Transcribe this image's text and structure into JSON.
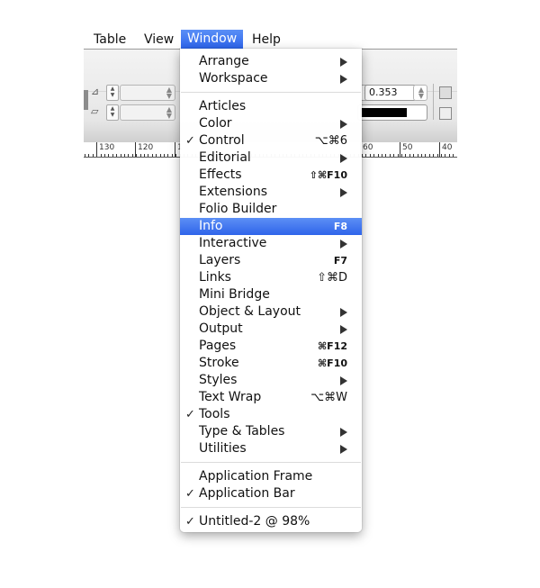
{
  "menubar": {
    "items": [
      {
        "label": "Table"
      },
      {
        "label": "View"
      },
      {
        "label": "Window",
        "active": true
      },
      {
        "label": "Help"
      }
    ]
  },
  "toolbar": {
    "stroke_weight_value": "0.353 mm",
    "ruler_labels": [
      "130",
      "120",
      "1",
      "60",
      "50",
      "40"
    ]
  },
  "window_menu": {
    "groups": [
      [
        {
          "label": "Arrange",
          "submenu": true
        },
        {
          "label": "Workspace",
          "submenu": true
        }
      ],
      [
        {
          "label": "Articles"
        },
        {
          "label": "Color",
          "submenu": true
        },
        {
          "label": "Control",
          "checked": true,
          "shortcut": "⌥⌘6"
        },
        {
          "label": "Editorial",
          "submenu": true
        },
        {
          "label": "Effects",
          "shortcut": "⇧⌘F10"
        },
        {
          "label": "Extensions",
          "submenu": true
        },
        {
          "label": "Folio Builder"
        },
        {
          "label": "Info",
          "shortcut": "F8",
          "highlighted": true
        },
        {
          "label": "Interactive",
          "submenu": true
        },
        {
          "label": "Layers",
          "shortcut": "F7"
        },
        {
          "label": "Links",
          "shortcut": "⇧⌘D"
        },
        {
          "label": "Mini Bridge"
        },
        {
          "label": "Object & Layout",
          "submenu": true
        },
        {
          "label": "Output",
          "submenu": true
        },
        {
          "label": "Pages",
          "shortcut": "⌘F12"
        },
        {
          "label": "Stroke",
          "shortcut": "⌘F10"
        },
        {
          "label": "Styles",
          "submenu": true
        },
        {
          "label": "Text Wrap",
          "shortcut": "⌥⌘W"
        },
        {
          "label": "Tools",
          "checked": true
        },
        {
          "label": "Type & Tables",
          "submenu": true
        },
        {
          "label": "Utilities",
          "submenu": true
        }
      ],
      [
        {
          "label": "Application Frame"
        },
        {
          "label": "Application Bar",
          "checked": true
        }
      ],
      [
        {
          "label": "Untitled-2 @ 98%",
          "checked": true
        }
      ]
    ]
  },
  "colors": {
    "highlight": "#3a6ff0",
    "menu_background": "#ffffff"
  }
}
